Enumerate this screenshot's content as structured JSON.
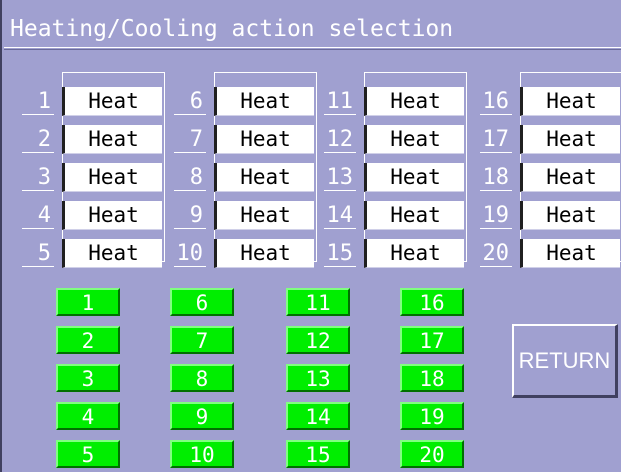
{
  "title": "Heating/Cooling action selection",
  "channels": [
    {
      "num": "1",
      "action": "Heat"
    },
    {
      "num": "2",
      "action": "Heat"
    },
    {
      "num": "3",
      "action": "Heat"
    },
    {
      "num": "4",
      "action": "Heat"
    },
    {
      "num": "5",
      "action": "Heat"
    },
    {
      "num": "6",
      "action": "Heat"
    },
    {
      "num": "7",
      "action": "Heat"
    },
    {
      "num": "8",
      "action": "Heat"
    },
    {
      "num": "9",
      "action": "Heat"
    },
    {
      "num": "10",
      "action": "Heat"
    },
    {
      "num": "11",
      "action": "Heat"
    },
    {
      "num": "12",
      "action": "Heat"
    },
    {
      "num": "13",
      "action": "Heat"
    },
    {
      "num": "14",
      "action": "Heat"
    },
    {
      "num": "15",
      "action": "Heat"
    },
    {
      "num": "16",
      "action": "Heat"
    },
    {
      "num": "17",
      "action": "Heat"
    },
    {
      "num": "18",
      "action": "Heat"
    },
    {
      "num": "19",
      "action": "Heat"
    },
    {
      "num": "20",
      "action": "Heat"
    }
  ],
  "select_buttons": [
    "1",
    "2",
    "3",
    "4",
    "5",
    "6",
    "7",
    "8",
    "9",
    "10",
    "11",
    "12",
    "13",
    "14",
    "15",
    "16",
    "17",
    "18",
    "19",
    "20"
  ],
  "return_label": "RETURN",
  "colors": {
    "background": "#a0a0d0",
    "button_green": "#00ee00",
    "value_box": "#ffffff"
  }
}
